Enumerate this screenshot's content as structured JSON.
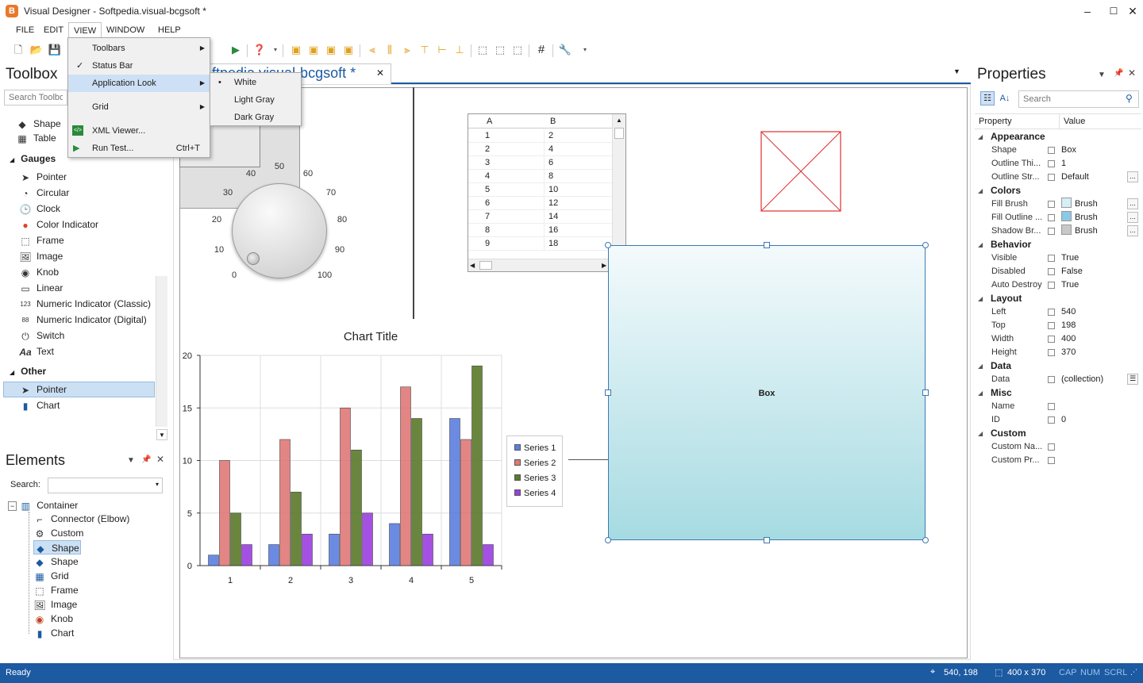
{
  "window": {
    "title": "Visual Designer - Softpedia.visual-bcgsoft *",
    "app_icon": "B"
  },
  "menu": [
    "FILE",
    "EDIT",
    "VIEW",
    "WINDOW",
    "HELP"
  ],
  "view_menu": {
    "items": [
      {
        "label": "Toolbars",
        "check": "",
        "shortcut": "",
        "submenu": true
      },
      {
        "label": "Status Bar",
        "check": "✓",
        "shortcut": "",
        "submenu": false
      },
      {
        "label": "Application Look",
        "check": "",
        "shortcut": "",
        "submenu": true
      },
      {
        "label": "Grid",
        "check": "",
        "shortcut": "",
        "submenu": true
      },
      {
        "label": "XML Viewer...",
        "check": "",
        "shortcut": "",
        "submenu": false
      },
      {
        "label": "Run Test...",
        "check": "",
        "shortcut": "Ctrl+T",
        "submenu": false
      }
    ]
  },
  "look_submenu": [
    {
      "label": "White",
      "bullet": "•"
    },
    {
      "label": "Light Gray",
      "bullet": ""
    },
    {
      "label": "Dark Gray",
      "bullet": ""
    }
  ],
  "toolbox": {
    "title": "Toolbox",
    "search_placeholder": "Search Toolbox",
    "top_items": [
      "Shape",
      "Table"
    ],
    "groups": [
      {
        "name": "Gauges",
        "items": [
          "Pointer",
          "Circular",
          "Clock",
          "Color Indicator",
          "Frame",
          "Image",
          "Knob",
          "Linear",
          "Numeric Indicator (Classic)",
          "Numeric Indicator (Digital)",
          "Switch",
          "Text"
        ]
      },
      {
        "name": "Other",
        "items": [
          "Pointer",
          "Chart"
        ]
      }
    ]
  },
  "elements": {
    "title": "Elements",
    "search_label": "Search:",
    "root": "Container",
    "children": [
      "Connector (Elbow)",
      "Custom",
      "Shape",
      "Shape",
      "Grid",
      "Frame",
      "Image",
      "Knob",
      "Chart"
    ]
  },
  "document_tab": {
    "label": "Softpedia.visual-bcgsoft *",
    "visible_label": "ftpedia.visual-bcgsoft *"
  },
  "knob": {
    "ticks": [
      "0",
      "10",
      "20",
      "30",
      "40",
      "50",
      "60",
      "70",
      "80",
      "90",
      "100"
    ]
  },
  "grid_widget": {
    "headers": [
      "A",
      "B"
    ],
    "rows": [
      [
        "1",
        "2"
      ],
      [
        "2",
        "4"
      ],
      [
        "3",
        "6"
      ],
      [
        "4",
        "8"
      ],
      [
        "5",
        "10"
      ],
      [
        "6",
        "12"
      ],
      [
        "7",
        "14"
      ],
      [
        "8",
        "16"
      ],
      [
        "9",
        "18"
      ]
    ]
  },
  "box": {
    "label": "Box"
  },
  "chart_data": {
    "type": "bar",
    "title": "Chart Title",
    "categories": [
      "1",
      "2",
      "3",
      "4",
      "5"
    ],
    "ylim": [
      0,
      20
    ],
    "yticks": [
      0,
      5,
      10,
      15,
      20
    ],
    "series": [
      {
        "name": "Series 1",
        "color": "#5b7fe0",
        "values": [
          1,
          2,
          3,
          4,
          14
        ]
      },
      {
        "name": "Series 2",
        "color": "#e07878",
        "values": [
          10,
          12,
          15,
          17,
          12
        ]
      },
      {
        "name": "Series 3",
        "color": "#5a7a2a",
        "values": [
          5,
          7,
          11,
          14,
          19
        ]
      },
      {
        "name": "Series 4",
        "color": "#9b3fe0",
        "values": [
          2,
          3,
          5,
          3,
          2
        ]
      }
    ],
    "grid": true,
    "legend": "right"
  },
  "properties": {
    "title": "Properties",
    "search_placeholder": "Search",
    "col_property": "Property",
    "col_value": "Value",
    "categories": [
      {
        "name": "Appearance",
        "rows": [
          [
            "Shape",
            "Box"
          ],
          [
            "Outline Thi...",
            "1"
          ],
          [
            "Outline Str...",
            "Default"
          ]
        ]
      },
      {
        "name": "Colors",
        "rows": [
          [
            "Fill Brush",
            "Brush"
          ],
          [
            "Fill Outline ...",
            "Brush"
          ],
          [
            "Shadow Br...",
            "Brush"
          ]
        ]
      },
      {
        "name": "Behavior",
        "rows": [
          [
            "Visible",
            "True"
          ],
          [
            "Disabled",
            "False"
          ],
          [
            "Auto Destroy",
            "True"
          ]
        ]
      },
      {
        "name": "Layout",
        "rows": [
          [
            "Left",
            "540"
          ],
          [
            "Top",
            "198"
          ],
          [
            "Width",
            "400"
          ],
          [
            "Height",
            "370"
          ]
        ]
      },
      {
        "name": "Data",
        "rows": [
          [
            "Data",
            "(collection)"
          ]
        ]
      },
      {
        "name": "Misc",
        "rows": [
          [
            "Name",
            ""
          ],
          [
            "ID",
            "0"
          ]
        ]
      },
      {
        "name": "Custom",
        "rows": [
          [
            "Custom Na...",
            ""
          ],
          [
            "Custom Pr...",
            ""
          ]
        ]
      }
    ],
    "swatch_colors": [
      "#d6eef5",
      "#8cc8e8",
      "#c8c8c8"
    ]
  },
  "status": {
    "ready": "Ready",
    "position": "540, 198",
    "size": "400 x 370",
    "indicators": [
      "CAP",
      "NUM",
      "SCRL"
    ]
  },
  "colors": {
    "accent": "#1c5aa1",
    "selection": "#cce0f4",
    "box_top": "#f4fafc",
    "box_bottom": "#a6dbe2"
  }
}
